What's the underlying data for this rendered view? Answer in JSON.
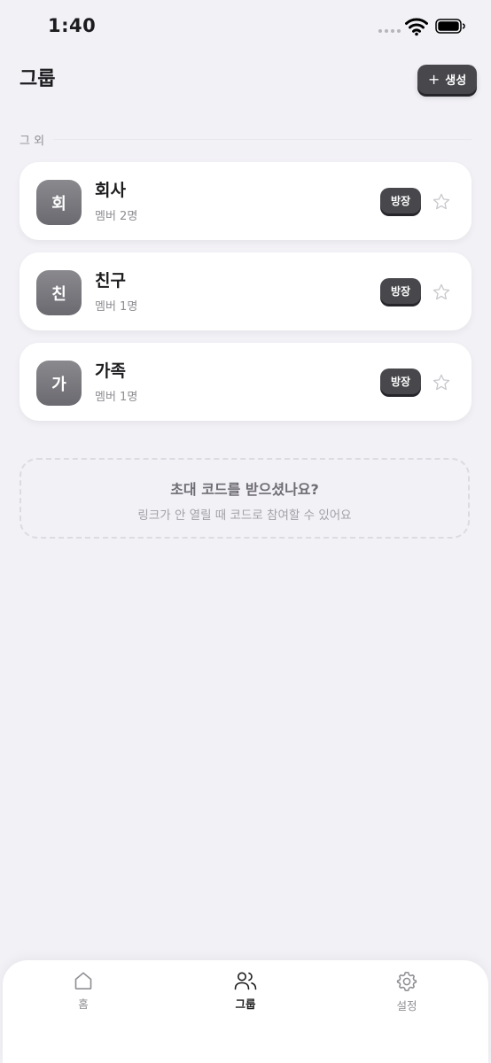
{
  "status_bar": {
    "time": "1:40"
  },
  "header": {
    "title": "그룹",
    "create_button_label": "생성"
  },
  "section": {
    "label": "그 외"
  },
  "groups": [
    {
      "initial": "회",
      "name": "회사",
      "members": "멤버 2명",
      "role": "방장"
    },
    {
      "initial": "친",
      "name": "친구",
      "members": "멤버 1명",
      "role": "방장"
    },
    {
      "initial": "가",
      "name": "가족",
      "members": "멤버 1명",
      "role": "방장"
    }
  ],
  "invite": {
    "title": "초대 코드를 받으셨나요?",
    "subtitle": "링크가 안 열릴 때 코드로 참여할 수 있어요"
  },
  "tabs": [
    {
      "label": "홈",
      "icon": "home-icon",
      "active": false
    },
    {
      "label": "그룹",
      "icon": "users-icon",
      "active": true
    },
    {
      "label": "설정",
      "icon": "gear-icon",
      "active": false
    }
  ],
  "colors": {
    "background": "#f2f1f6",
    "accent": "#48474c",
    "muted_text": "#8e8e93"
  }
}
